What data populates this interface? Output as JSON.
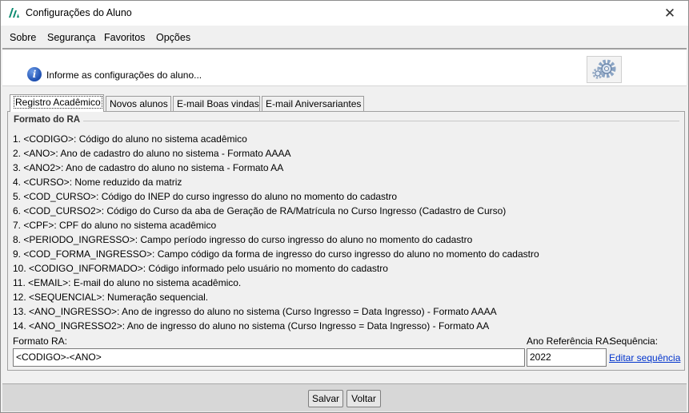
{
  "window": {
    "title": "Configurações do Aluno",
    "close_symbol": "✕",
    "accent_color": "#0b8a6f"
  },
  "menu": [
    {
      "label": "Sobre"
    },
    {
      "label": "Segurança"
    },
    {
      "label": "Favoritos"
    },
    {
      "label": "Opções"
    }
  ],
  "header": {
    "info_icon_glyph": "i",
    "message": "Informe as configurações do aluno...",
    "icon": "gear-icon"
  },
  "tabs": [
    {
      "label": "Registro Acadêmico",
      "active": true
    },
    {
      "label": "Novos alunos",
      "active": false
    },
    {
      "label": "E-mail Boas vindas",
      "active": false
    },
    {
      "label": "E-mail Aniversariantes",
      "active": false
    }
  ],
  "group": {
    "title": "Formato do RA",
    "items": [
      "1. <CODIGO>: Código do aluno no sistema acadêmico",
      "2. <ANO>: Ano de cadastro do aluno no sistema - Formato AAAA",
      "3. <ANO2>: Ano de cadastro do aluno no sistema - Formato AA",
      "4. <CURSO>: Nome reduzido da matriz",
      "5. <COD_CURSO>: Código do INEP do curso ingresso do aluno no momento do cadastro",
      "6. <COD_CURSO2>: Código do Curso da aba de Geração de RA/Matrícula no Curso Ingresso (Cadastro de Curso)",
      "7. <CPF>: CPF do aluno no sistema acadêmico",
      "8. <PERIODO_INGRESSO>: Campo período ingresso do curso ingresso do aluno no momento do cadastro",
      "9. <COD_FORMA_INGRESSO>: Campo código da forma de ingresso do curso ingresso do aluno no momento do cadastro",
      "10. <CODIGO_INFORMADO>: Código informado pelo usuário no momento do cadastro",
      "11. <EMAIL>: E-mail do aluno no sistema acadêmico.",
      "12. <SEQUENCIAL>: Numeração sequencial.",
      "13. <ANO_INGRESSO>: Ano de ingresso do aluno no sistema (Curso Ingresso = Data Ingresso) - Formato AAAA",
      "14. <ANO_INGRESSO2>: Ano de ingresso do aluno no sistema (Curso Ingresso = Data Ingresso) - Formato AA"
    ]
  },
  "form": {
    "formato_label": "Formato RA:",
    "formato_value": "<CODIGO>-<ANO>",
    "ano_label": "Ano Referência RA:",
    "ano_value": "2022",
    "sequencia_label": "Sequência:",
    "sequencia_link": "Editar sequência"
  },
  "buttons": {
    "save": "Salvar",
    "back": "Voltar"
  }
}
